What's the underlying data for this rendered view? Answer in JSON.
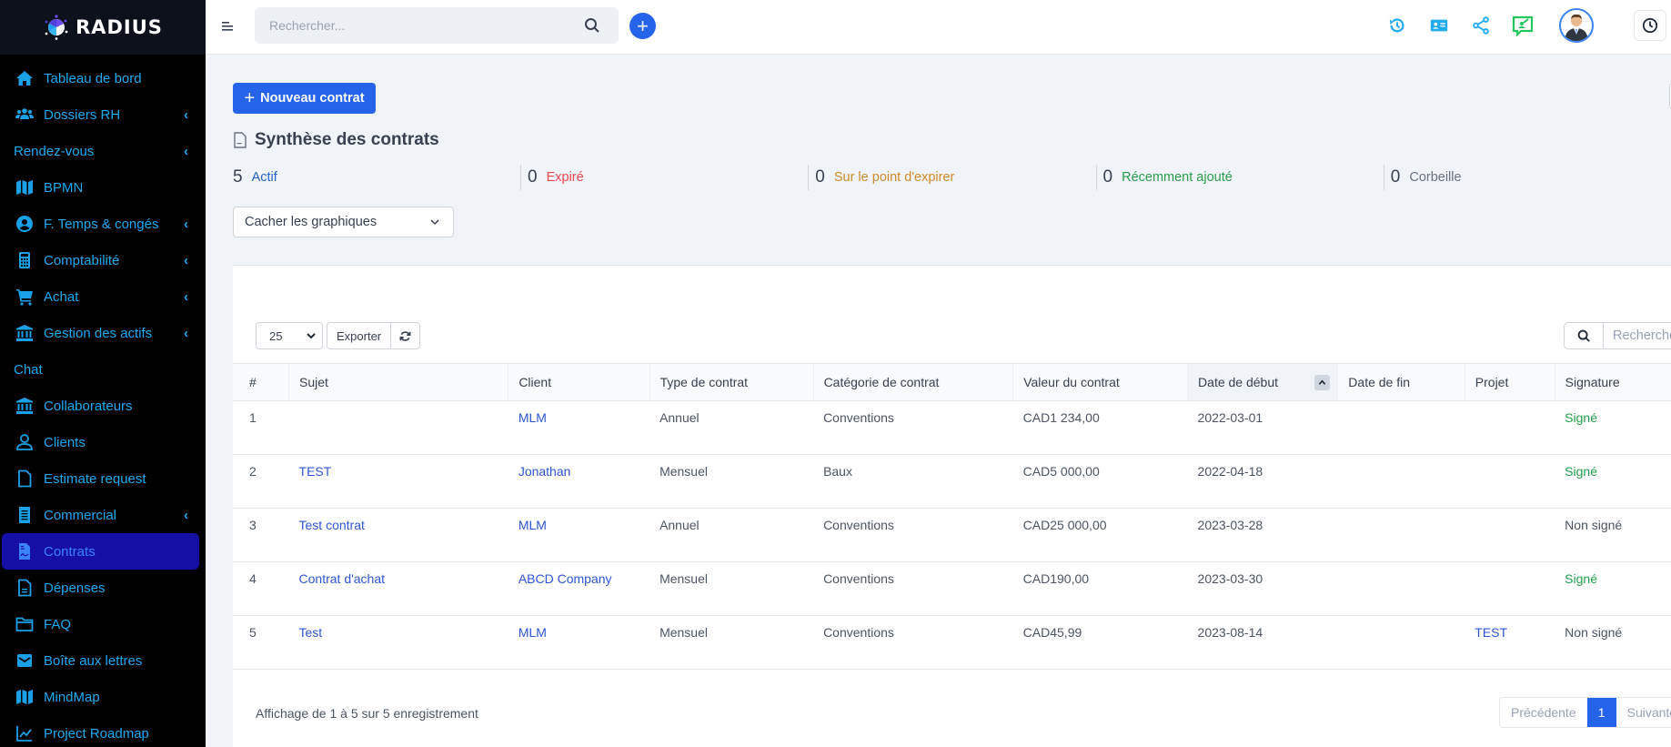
{
  "brand": {
    "name": "RADIUS"
  },
  "sidebar": {
    "items": [
      {
        "label": "Tableau de bord",
        "icon": "home-icon",
        "chevron": false
      },
      {
        "label": "Dossiers RH",
        "icon": "users-icon",
        "chevron": true
      },
      {
        "label": "Rendez-vous",
        "icon": null,
        "chevron": true
      },
      {
        "label": "BPMN",
        "icon": "map-icon",
        "chevron": false
      },
      {
        "label": "F. Temps & congés",
        "icon": "user-circle-icon",
        "chevron": true
      },
      {
        "label": "Comptabilité",
        "icon": "calculator-icon",
        "chevron": true
      },
      {
        "label": "Achat",
        "icon": "cart-icon",
        "chevron": true
      },
      {
        "label": "Gestion des actifs",
        "icon": "bank-icon",
        "chevron": true
      },
      {
        "label": "Chat",
        "icon": null,
        "chevron": false
      },
      {
        "label": "Collaborateurs",
        "icon": "bank-icon",
        "chevron": false
      },
      {
        "label": "Clients",
        "icon": "user-icon",
        "chevron": false
      },
      {
        "label": "Estimate request",
        "icon": "file-icon",
        "chevron": false
      },
      {
        "label": "Commercial",
        "icon": "receipt-icon",
        "chevron": true
      },
      {
        "label": "Contrats",
        "icon": "contract-icon",
        "chevron": false,
        "active": true
      },
      {
        "label": "Dépenses",
        "icon": "file-text-icon",
        "chevron": false
      },
      {
        "label": "FAQ",
        "icon": "folder-icon",
        "chevron": false
      },
      {
        "label": "Boîte aux lettres",
        "icon": "mail-icon",
        "chevron": false
      },
      {
        "label": "MindMap",
        "icon": "map-icon",
        "chevron": false
      },
      {
        "label": "Project Roadmap",
        "icon": "chart-line-icon",
        "chevron": false
      }
    ],
    "chevron_glyph": "‹"
  },
  "topbar": {
    "search_placeholder": "Rechercher...",
    "add_glyph": "+",
    "icons": [
      "history-icon",
      "id-card-icon",
      "share-icon",
      "presentation-icon",
      "avatar",
      "clock-icon"
    ]
  },
  "main": {
    "new_button": {
      "glyph": "+",
      "label": "Nouveau contrat"
    },
    "summary_title": "Synthèse des contrats",
    "stats": [
      {
        "count": "5",
        "label": "Actif",
        "color": "#2563c9"
      },
      {
        "count": "0",
        "label": "Expiré",
        "color": "#e5484d"
      },
      {
        "count": "0",
        "label": "Sur le point d'expirer",
        "color": "#d08a2b"
      },
      {
        "count": "0",
        "label": "Récemment ajouté",
        "color": "#2a9d4b"
      },
      {
        "count": "0",
        "label": "Corbeille",
        "color": "#6b7280"
      }
    ],
    "charts_toggle": {
      "selected": "Cacher les graphiques"
    }
  },
  "table": {
    "page_size": "25",
    "export_label": "Exporter",
    "search_placeholder": "Rechercher",
    "columns": [
      "#",
      "Sujet",
      "Client",
      "Type de contrat",
      "Catégorie de contrat",
      "Valeur du contrat",
      "Date de début",
      "Date de fin",
      "Projet",
      "Signature"
    ],
    "sorted_column": "Date de début",
    "rows": [
      {
        "num": "1",
        "subject": "",
        "client": "MLM",
        "type": "Annuel",
        "category": "Conventions",
        "value": "CAD1 234,00",
        "start": "2022-03-01",
        "end": "",
        "project": "",
        "signature": "Signé",
        "signed": true
      },
      {
        "num": "2",
        "subject": "TEST",
        "client": "Jonathan",
        "type": "Mensuel",
        "category": "Baux",
        "value": "CAD5 000,00",
        "start": "2022-04-18",
        "end": "",
        "project": "",
        "signature": "Signé",
        "signed": true
      },
      {
        "num": "3",
        "subject": "Test contrat",
        "client": "MLM",
        "type": "Annuel",
        "category": "Conventions",
        "value": "CAD25 000,00",
        "start": "2023-03-28",
        "end": "",
        "project": "",
        "signature": "Non signé",
        "signed": false
      },
      {
        "num": "4",
        "subject": "Contrat d'achat",
        "client": "ABCD Company",
        "type": "Mensuel",
        "category": "Conventions",
        "value": "CAD190,00",
        "start": "2023-03-30",
        "end": "",
        "project": "",
        "signature": "Signé",
        "signed": true
      },
      {
        "num": "5",
        "subject": "Test",
        "client": "MLM",
        "type": "Mensuel",
        "category": "Conventions",
        "value": "CAD45,99",
        "start": "2023-08-14",
        "end": "",
        "project": "TEST",
        "signature": "Non signé",
        "signed": false
      }
    ],
    "info": "Affichage de 1 à 5 sur 5 enregistrement",
    "pagination": {
      "prev": "Précédente",
      "current": "1",
      "next": "Suivante"
    }
  }
}
